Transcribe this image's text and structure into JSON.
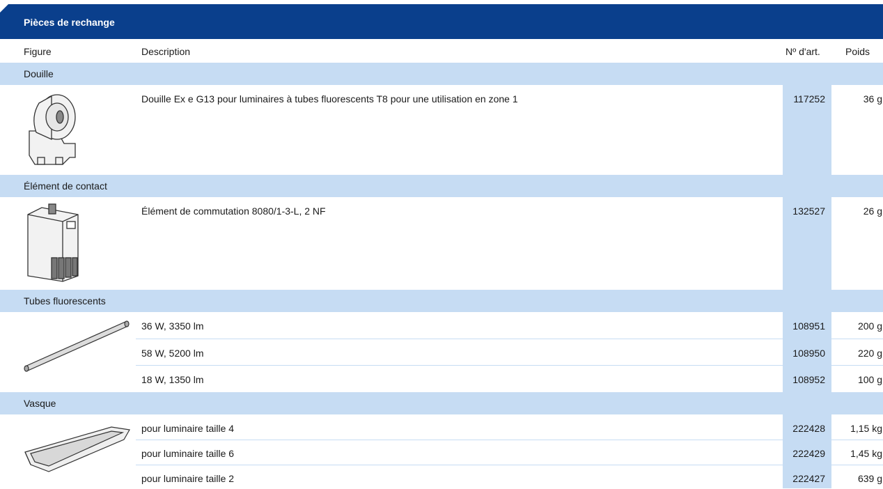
{
  "title": "Pièces de rechange",
  "columns": {
    "figure": "Figure",
    "description": "Description",
    "art_no": "Nº d'art.",
    "weight": "Poids"
  },
  "sections": [
    {
      "name": "Douille",
      "icon": "socket-image",
      "items": [
        {
          "description": "Douille Ex e G13 pour luminaires à tubes fluorescents T8 pour une utilisation en zone 1",
          "art_no": "117252",
          "weight": "36 g"
        }
      ]
    },
    {
      "name": "Élément de contact",
      "icon": "contact-element-image",
      "items": [
        {
          "description": "Élément de commutation 8080/1-3-L, 2 NF",
          "art_no": "132527",
          "weight": "26 g"
        }
      ]
    },
    {
      "name": "Tubes fluorescents",
      "icon": "fluorescent-tube-image",
      "items": [
        {
          "description": "36 W, 3350 lm",
          "art_no": "108951",
          "weight": "200 g"
        },
        {
          "description": "58 W, 5200 lm",
          "art_no": "108950",
          "weight": "220 g"
        },
        {
          "description": "18 W, 1350 lm",
          "art_no": "108952",
          "weight": "100 g"
        }
      ]
    },
    {
      "name": "Vasque",
      "icon": "basin-image",
      "items": [
        {
          "description": "pour luminaire taille 4",
          "art_no": "222428",
          "weight": "1,15 kg"
        },
        {
          "description": "pour luminaire taille 6",
          "art_no": "222429",
          "weight": "1,45 kg"
        },
        {
          "description": "pour luminaire taille 2",
          "art_no": "222427",
          "weight": "639 g"
        }
      ]
    }
  ]
}
